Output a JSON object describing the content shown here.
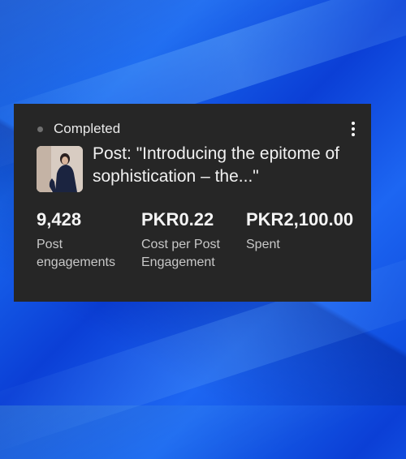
{
  "card": {
    "status": "Completed",
    "post_title": "Post: \"Introducing the epitome of sophistication – the...\"",
    "metrics": [
      {
        "value": "9,428",
        "label": "Post engagements"
      },
      {
        "value": "PKR0.22",
        "label": "Cost per Post Engagement"
      },
      {
        "value": "PKR2,100.00",
        "label": "Spent"
      }
    ]
  },
  "icons": {
    "status": "status-dot-icon",
    "menu": "more-vert-icon"
  },
  "colors": {
    "card_bg": "#262626",
    "status_dot": "#6f6f6f",
    "background": "#1a6af0"
  }
}
